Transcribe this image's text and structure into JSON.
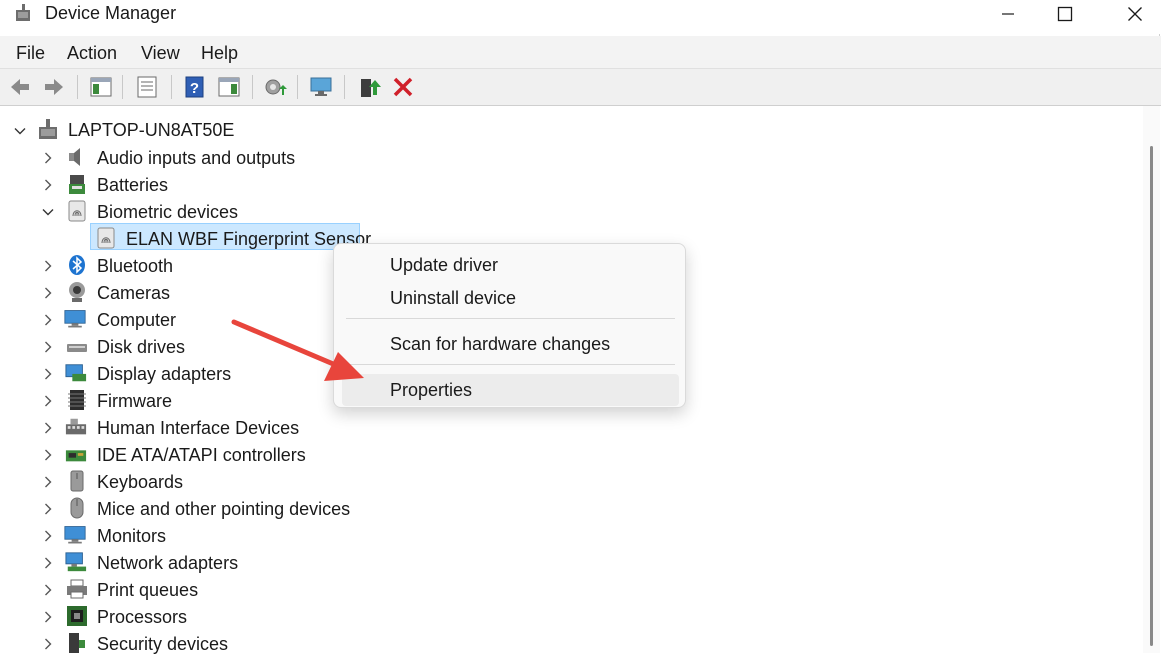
{
  "window": {
    "title": "Device Manager",
    "controls": [
      "minimize",
      "maximize",
      "close"
    ]
  },
  "menu": {
    "items": [
      "File",
      "Action",
      "View",
      "Help"
    ]
  },
  "toolbar": {
    "buttons": [
      "back-icon",
      "forward-icon",
      "show-hide-console-tree-icon",
      "properties-icon",
      "help-icon",
      "action-pane-icon",
      "update-driver-icon",
      "scan-hardware-icon",
      "enable-device-icon",
      "uninstall-icon"
    ]
  },
  "tree": {
    "root": "LAPTOP-UN8AT50E",
    "categories": [
      {
        "label": "Audio inputs and outputs",
        "icon": "speaker-icon",
        "expanded": false
      },
      {
        "label": "Batteries",
        "icon": "battery-icon",
        "expanded": false
      },
      {
        "label": "Biometric devices",
        "icon": "fingerprint-icon",
        "expanded": true
      },
      {
        "label": "ELAN WBF Fingerprint Sensor",
        "icon": "fingerprint-icon",
        "child": true,
        "selected": true
      },
      {
        "label": "Bluetooth",
        "icon": "bluetooth-icon",
        "expanded": false
      },
      {
        "label": "Cameras",
        "icon": "camera-icon",
        "expanded": false
      },
      {
        "label": "Computer",
        "icon": "monitor-icon",
        "expanded": false
      },
      {
        "label": "Disk drives",
        "icon": "disk-icon",
        "expanded": false
      },
      {
        "label": "Display adapters",
        "icon": "display-adapter-icon",
        "expanded": false
      },
      {
        "label": "Firmware",
        "icon": "chip-icon",
        "expanded": false
      },
      {
        "label": "Human Interface Devices",
        "icon": "hid-icon",
        "expanded": false
      },
      {
        "label": "IDE ATA/ATAPI controllers",
        "icon": "ide-icon",
        "expanded": false
      },
      {
        "label": "Keyboards",
        "icon": "keyboard-icon",
        "expanded": false
      },
      {
        "label": "Mice and other pointing devices",
        "icon": "mouse-icon",
        "expanded": false
      },
      {
        "label": "Monitors",
        "icon": "monitor-icon",
        "expanded": false
      },
      {
        "label": "Network adapters",
        "icon": "network-icon",
        "expanded": false
      },
      {
        "label": "Print queues",
        "icon": "printer-icon",
        "expanded": false
      },
      {
        "label": "Processors",
        "icon": "processor-icon",
        "expanded": false
      },
      {
        "label": "Security devices",
        "icon": "security-icon",
        "expanded": false
      }
    ]
  },
  "context_menu": {
    "items": [
      "Update driver",
      "Uninstall device",
      "Scan for hardware changes",
      "Properties"
    ],
    "highlighted": "Properties"
  },
  "colors": {
    "selection_bg": "#cce8ff",
    "selection_border": "#99d1ff",
    "annotation_arrow": "#e8453c",
    "menubar_bg": "#f3f3f3",
    "toolbar_bg": "#f0f0f0"
  }
}
